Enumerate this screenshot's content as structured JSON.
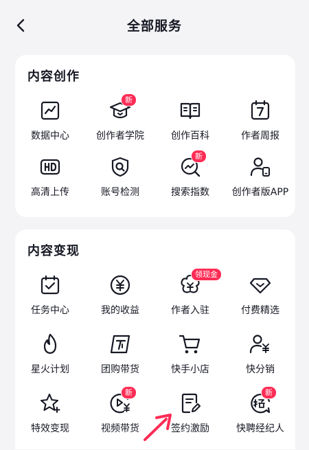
{
  "header": {
    "title": "全部服务"
  },
  "sections": [
    {
      "title": "内容创作",
      "items": [
        {
          "label": "数据中心",
          "icon": "chart-icon"
        },
        {
          "label": "创作者学院",
          "icon": "graduation-cap-icon",
          "badge": "新"
        },
        {
          "label": "创作百科",
          "icon": "open-book-icon"
        },
        {
          "label": "作者周报",
          "icon": "calendar-7-icon"
        },
        {
          "label": "高清上传",
          "icon": "hd-icon"
        },
        {
          "label": "账号检测",
          "icon": "shield-search-icon"
        },
        {
          "label": "搜索指数",
          "icon": "search-trend-icon",
          "badge": "新"
        },
        {
          "label": "创作者版APP",
          "icon": "user-phone-icon"
        }
      ]
    },
    {
      "title": "内容变现",
      "items": [
        {
          "label": "任务中心",
          "icon": "calendar-check-icon"
        },
        {
          "label": "我的收益",
          "icon": "yuan-coin-icon"
        },
        {
          "label": "作者入驻",
          "icon": "flower-badge-icon",
          "badge": "领现金"
        },
        {
          "label": "付费精选",
          "icon": "diamond-icon"
        },
        {
          "label": "星火计划",
          "icon": "flame-icon"
        },
        {
          "label": "团购带货",
          "icon": "group-buy-icon"
        },
        {
          "label": "快手小店",
          "icon": "cart-icon"
        },
        {
          "label": "快分销",
          "icon": "user-yuan-icon"
        },
        {
          "label": "特效变现",
          "icon": "star-sparkle-icon"
        },
        {
          "label": "视频带货",
          "icon": "video-yuan-icon",
          "badge": "新"
        },
        {
          "label": "签约激励",
          "icon": "contract-edit-icon"
        },
        {
          "label": "快聘经纪人",
          "icon": "recruit-icon",
          "badge": "新"
        }
      ]
    }
  ],
  "colors": {
    "accent": "#fe2c55",
    "text": "#161823",
    "background": "#f4f4f6"
  }
}
